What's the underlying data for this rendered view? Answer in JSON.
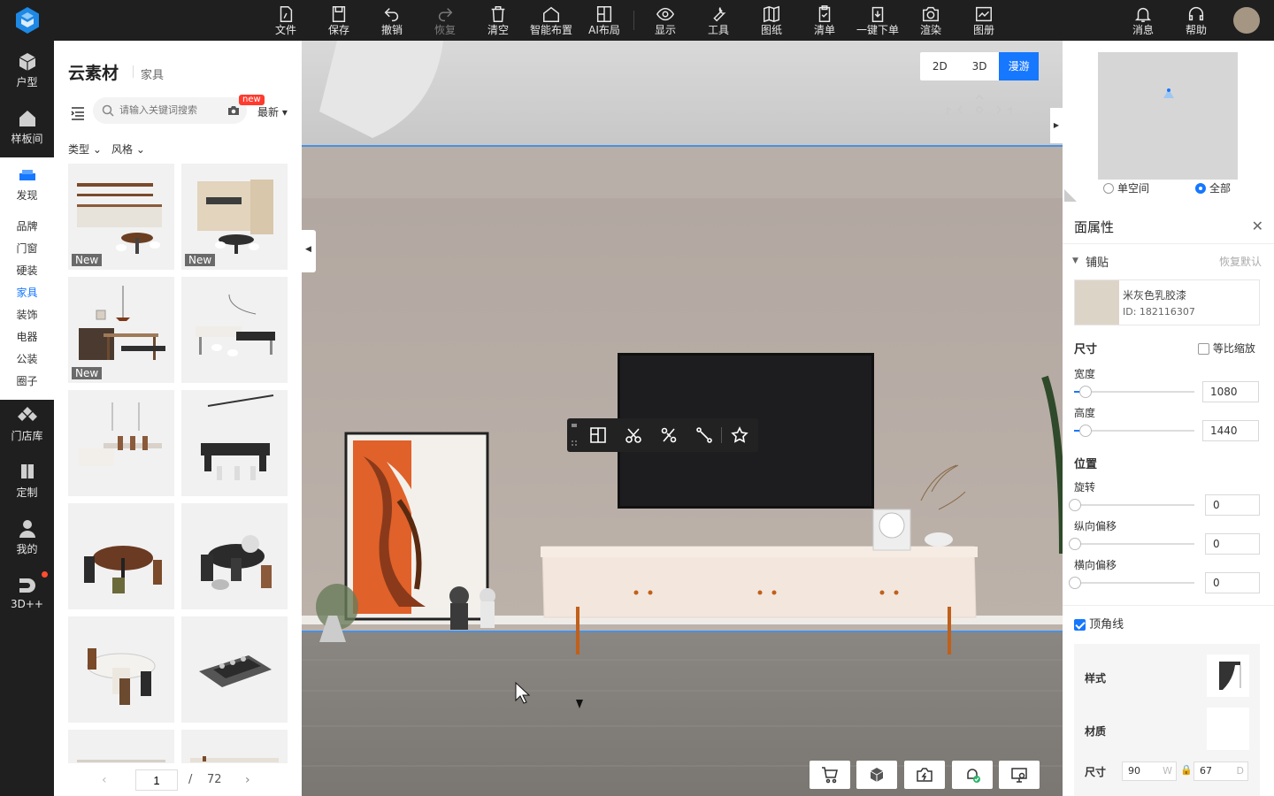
{
  "toolbar": {
    "items": [
      {
        "label": "文件",
        "icon": "file-icon"
      },
      {
        "label": "保存",
        "icon": "save-icon"
      },
      {
        "label": "撤销",
        "icon": "undo-icon"
      },
      {
        "label": "恢复",
        "icon": "redo-icon",
        "disabled": true
      },
      {
        "label": "清空",
        "icon": "trash-icon"
      },
      {
        "label": "智能布置",
        "icon": "house-icon"
      },
      {
        "label": "AI布局",
        "icon": "ai-layout-icon"
      },
      {
        "label": "显示",
        "icon": "eye-icon"
      },
      {
        "label": "工具",
        "icon": "wrench-icon"
      },
      {
        "label": "图纸",
        "icon": "map-icon"
      },
      {
        "label": "清单",
        "icon": "clipboard-icon"
      },
      {
        "label": "一键下单",
        "icon": "order-icon"
      },
      {
        "label": "渲染",
        "icon": "camera-icon"
      },
      {
        "label": "图册",
        "icon": "album-icon"
      }
    ],
    "messages": "消息",
    "help": "帮助"
  },
  "leftnav": {
    "floorplan": "户型",
    "showroom": "样板间",
    "cloud": "发现",
    "sub": [
      "品牌",
      "门窗",
      "硬装",
      "家具",
      "装饰",
      "电器",
      "公装",
      "圈子"
    ],
    "active_sub": "家具",
    "store": "门店库",
    "custom": "定制",
    "mine": "我的",
    "plus": "3D++"
  },
  "catalog": {
    "title": "云素材",
    "subtitle": "家具",
    "search_placeholder": "请输入关键词搜索",
    "new_tag": "new",
    "sort": "最新",
    "filter_type": "类型",
    "filter_style": "风格",
    "new_badge": "New",
    "page_current": "1",
    "page_slash": "/",
    "page_total": "72"
  },
  "scene": {
    "view_2d": "2D",
    "view_3d": "3D",
    "view_walk": "漫游",
    "active_view": "漫游"
  },
  "minimap": {
    "single_room": "单空间",
    "all": "全部",
    "selected": "全部"
  },
  "props": {
    "title": "面属性",
    "section_tile": "铺贴",
    "reset": "恢复默认",
    "material_name": "米灰色乳胶漆",
    "material_id": "ID: 182116307",
    "size_label": "尺寸",
    "proportional": "等比缩放",
    "width_label": "宽度",
    "width_value": "1080",
    "height_label": "高度",
    "height_value": "1440",
    "position_label": "位置",
    "rotate_label": "旋转",
    "rotate_value": "0",
    "voffset_label": "纵向偏移",
    "voffset_value": "0",
    "hoffset_label": "横向偏移",
    "hoffset_value": "0",
    "crown_label": "顶角线",
    "style_label": "样式",
    "material_label": "材质",
    "crown_size_label": "尺寸",
    "crown_w": "90",
    "crown_w_unit": "W",
    "crown_d": "67",
    "crown_d_unit": "D",
    "colors": {
      "accent": "#1677ff",
      "wall": "#b7aca3",
      "floor": "#8f8a85"
    }
  }
}
